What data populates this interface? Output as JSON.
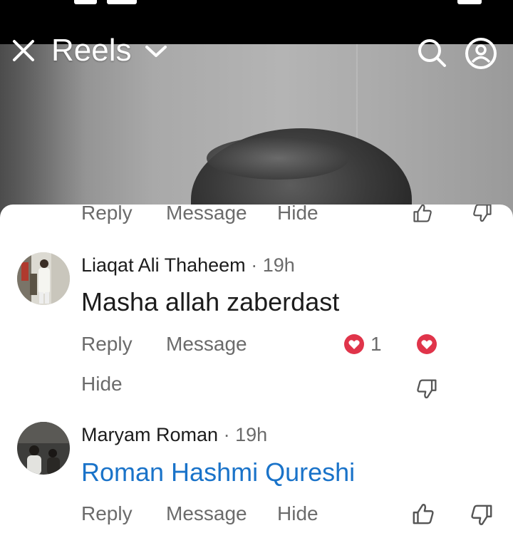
{
  "header": {
    "title": "Reels",
    "icons": [
      "close-icon",
      "chevron-down-icon",
      "search-icon",
      "profile-icon"
    ],
    "text_color": "#ffffff"
  },
  "colors": {
    "link": "#1a73c9",
    "action_text": "#6b6b6b",
    "reaction_red": "#e0344a"
  },
  "prev_actions": {
    "reply": "Reply",
    "message": "Message",
    "hide": "Hide"
  },
  "comments": [
    {
      "author": "Liaqat Ali Thaheem",
      "separator": "·",
      "time": "19h",
      "text": "Masha allah zaberdast",
      "reply": "Reply",
      "message": "Message",
      "hide": "Hide",
      "reaction_count": "1",
      "reaction_icon": "love-reaction-icon"
    },
    {
      "author": "Maryam Roman",
      "separator": "·",
      "time": "19h",
      "tag": "Roman Hashmi Qureshi",
      "reply": "Reply",
      "message": "Message",
      "hide": "Hide"
    }
  ]
}
